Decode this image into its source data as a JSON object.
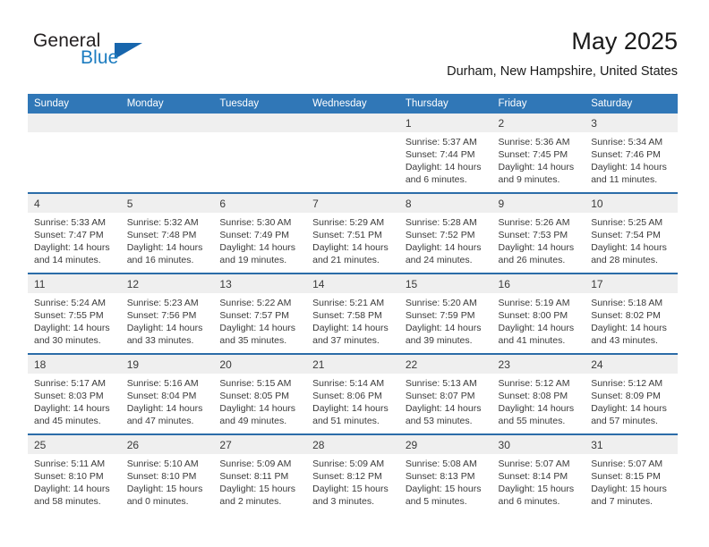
{
  "brand": {
    "name_part1": "General",
    "name_part2": "Blue",
    "flag_icon": "triangle-flag-icon"
  },
  "header": {
    "title": "May 2025",
    "location": "Durham, New Hampshire, United States"
  },
  "colors": {
    "header_blue": "#3077b7",
    "row_border_blue": "#2b6ca8",
    "brand_blue": "#1c7cc0",
    "flag_blue": "#1866ad",
    "daynum_band": "#efefef",
    "text": "#3a3a3a"
  },
  "calendar": {
    "weekday_headers": [
      "Sunday",
      "Monday",
      "Tuesday",
      "Wednesday",
      "Thursday",
      "Friday",
      "Saturday"
    ],
    "weeks": [
      [
        {
          "day": "",
          "empty": true
        },
        {
          "day": "",
          "empty": true
        },
        {
          "day": "",
          "empty": true
        },
        {
          "day": "",
          "empty": true
        },
        {
          "day": "1",
          "sunrise": "Sunrise: 5:37 AM",
          "sunset": "Sunset: 7:44 PM",
          "daylight": "Daylight: 14 hours and 6 minutes."
        },
        {
          "day": "2",
          "sunrise": "Sunrise: 5:36 AM",
          "sunset": "Sunset: 7:45 PM",
          "daylight": "Daylight: 14 hours and 9 minutes."
        },
        {
          "day": "3",
          "sunrise": "Sunrise: 5:34 AM",
          "sunset": "Sunset: 7:46 PM",
          "daylight": "Daylight: 14 hours and 11 minutes."
        }
      ],
      [
        {
          "day": "4",
          "sunrise": "Sunrise: 5:33 AM",
          "sunset": "Sunset: 7:47 PM",
          "daylight": "Daylight: 14 hours and 14 minutes."
        },
        {
          "day": "5",
          "sunrise": "Sunrise: 5:32 AM",
          "sunset": "Sunset: 7:48 PM",
          "daylight": "Daylight: 14 hours and 16 minutes."
        },
        {
          "day": "6",
          "sunrise": "Sunrise: 5:30 AM",
          "sunset": "Sunset: 7:49 PM",
          "daylight": "Daylight: 14 hours and 19 minutes."
        },
        {
          "day": "7",
          "sunrise": "Sunrise: 5:29 AM",
          "sunset": "Sunset: 7:51 PM",
          "daylight": "Daylight: 14 hours and 21 minutes."
        },
        {
          "day": "8",
          "sunrise": "Sunrise: 5:28 AM",
          "sunset": "Sunset: 7:52 PM",
          "daylight": "Daylight: 14 hours and 24 minutes."
        },
        {
          "day": "9",
          "sunrise": "Sunrise: 5:26 AM",
          "sunset": "Sunset: 7:53 PM",
          "daylight": "Daylight: 14 hours and 26 minutes."
        },
        {
          "day": "10",
          "sunrise": "Sunrise: 5:25 AM",
          "sunset": "Sunset: 7:54 PM",
          "daylight": "Daylight: 14 hours and 28 minutes."
        }
      ],
      [
        {
          "day": "11",
          "sunrise": "Sunrise: 5:24 AM",
          "sunset": "Sunset: 7:55 PM",
          "daylight": "Daylight: 14 hours and 30 minutes."
        },
        {
          "day": "12",
          "sunrise": "Sunrise: 5:23 AM",
          "sunset": "Sunset: 7:56 PM",
          "daylight": "Daylight: 14 hours and 33 minutes."
        },
        {
          "day": "13",
          "sunrise": "Sunrise: 5:22 AM",
          "sunset": "Sunset: 7:57 PM",
          "daylight": "Daylight: 14 hours and 35 minutes."
        },
        {
          "day": "14",
          "sunrise": "Sunrise: 5:21 AM",
          "sunset": "Sunset: 7:58 PM",
          "daylight": "Daylight: 14 hours and 37 minutes."
        },
        {
          "day": "15",
          "sunrise": "Sunrise: 5:20 AM",
          "sunset": "Sunset: 7:59 PM",
          "daylight": "Daylight: 14 hours and 39 minutes."
        },
        {
          "day": "16",
          "sunrise": "Sunrise: 5:19 AM",
          "sunset": "Sunset: 8:00 PM",
          "daylight": "Daylight: 14 hours and 41 minutes."
        },
        {
          "day": "17",
          "sunrise": "Sunrise: 5:18 AM",
          "sunset": "Sunset: 8:02 PM",
          "daylight": "Daylight: 14 hours and 43 minutes."
        }
      ],
      [
        {
          "day": "18",
          "sunrise": "Sunrise: 5:17 AM",
          "sunset": "Sunset: 8:03 PM",
          "daylight": "Daylight: 14 hours and 45 minutes."
        },
        {
          "day": "19",
          "sunrise": "Sunrise: 5:16 AM",
          "sunset": "Sunset: 8:04 PM",
          "daylight": "Daylight: 14 hours and 47 minutes."
        },
        {
          "day": "20",
          "sunrise": "Sunrise: 5:15 AM",
          "sunset": "Sunset: 8:05 PM",
          "daylight": "Daylight: 14 hours and 49 minutes."
        },
        {
          "day": "21",
          "sunrise": "Sunrise: 5:14 AM",
          "sunset": "Sunset: 8:06 PM",
          "daylight": "Daylight: 14 hours and 51 minutes."
        },
        {
          "day": "22",
          "sunrise": "Sunrise: 5:13 AM",
          "sunset": "Sunset: 8:07 PM",
          "daylight": "Daylight: 14 hours and 53 minutes."
        },
        {
          "day": "23",
          "sunrise": "Sunrise: 5:12 AM",
          "sunset": "Sunset: 8:08 PM",
          "daylight": "Daylight: 14 hours and 55 minutes."
        },
        {
          "day": "24",
          "sunrise": "Sunrise: 5:12 AM",
          "sunset": "Sunset: 8:09 PM",
          "daylight": "Daylight: 14 hours and 57 minutes."
        }
      ],
      [
        {
          "day": "25",
          "sunrise": "Sunrise: 5:11 AM",
          "sunset": "Sunset: 8:10 PM",
          "daylight": "Daylight: 14 hours and 58 minutes."
        },
        {
          "day": "26",
          "sunrise": "Sunrise: 5:10 AM",
          "sunset": "Sunset: 8:10 PM",
          "daylight": "Daylight: 15 hours and 0 minutes."
        },
        {
          "day": "27",
          "sunrise": "Sunrise: 5:09 AM",
          "sunset": "Sunset: 8:11 PM",
          "daylight": "Daylight: 15 hours and 2 minutes."
        },
        {
          "day": "28",
          "sunrise": "Sunrise: 5:09 AM",
          "sunset": "Sunset: 8:12 PM",
          "daylight": "Daylight: 15 hours and 3 minutes."
        },
        {
          "day": "29",
          "sunrise": "Sunrise: 5:08 AM",
          "sunset": "Sunset: 8:13 PM",
          "daylight": "Daylight: 15 hours and 5 minutes."
        },
        {
          "day": "30",
          "sunrise": "Sunrise: 5:07 AM",
          "sunset": "Sunset: 8:14 PM",
          "daylight": "Daylight: 15 hours and 6 minutes."
        },
        {
          "day": "31",
          "sunrise": "Sunrise: 5:07 AM",
          "sunset": "Sunset: 8:15 PM",
          "daylight": "Daylight: 15 hours and 7 minutes."
        }
      ]
    ]
  }
}
